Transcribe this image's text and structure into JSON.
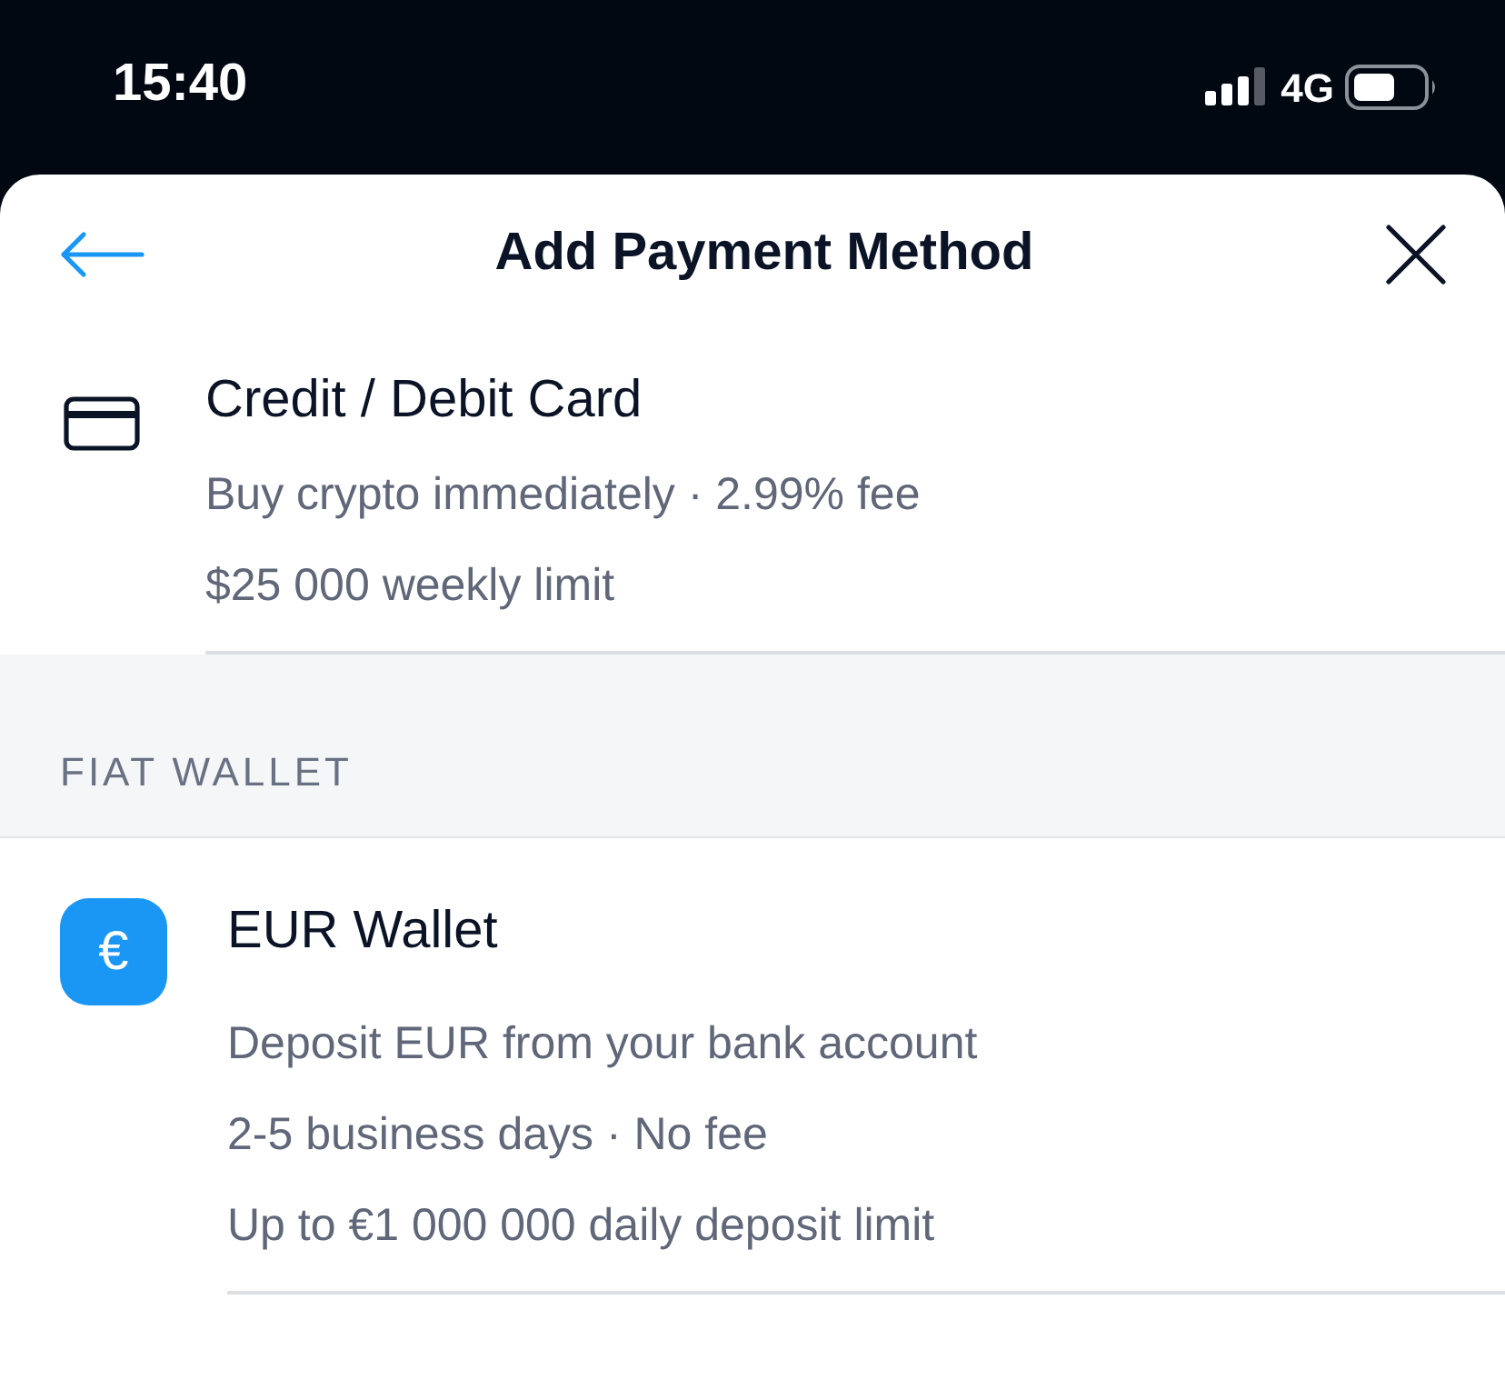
{
  "status_bar": {
    "time": "15:40",
    "network": "4G"
  },
  "header": {
    "title": "Add Payment Method"
  },
  "sections": [
    {
      "items": [
        {
          "kind": "card",
          "title": "Credit / Debit Card",
          "lines": [
            "Buy crypto immediately · 2.99% fee",
            "$25 000 weekly limit"
          ]
        }
      ]
    },
    {
      "heading": "FIAT WALLET",
      "items": [
        {
          "kind": "currency",
          "glyph": "€",
          "title": "EUR Wallet",
          "lines": [
            "Deposit EUR from your bank account",
            "2-5 business days · No fee",
            "Up to €1 000 000 daily deposit limit"
          ]
        }
      ]
    }
  ]
}
